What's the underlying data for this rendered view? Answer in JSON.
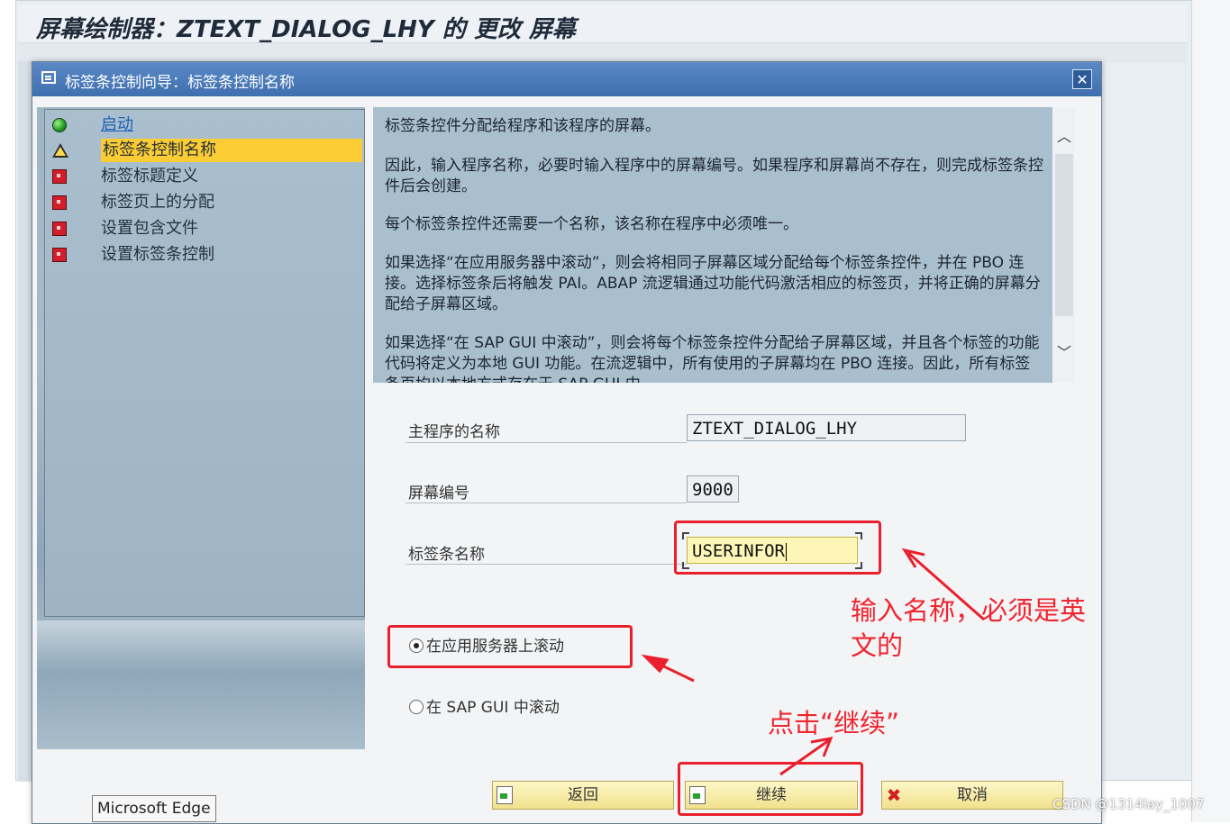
{
  "background_window": {
    "title": "屏幕绘制器：ZTEXT_DIALOG_LHY 的 更改 屏幕"
  },
  "dialog": {
    "title": "标签条控制向导：标签条控制名称",
    "close_label": "✕",
    "steps": [
      {
        "label": "启动",
        "status": "done",
        "icon": "green-light-icon"
      },
      {
        "label": "标签条控制名称",
        "status": "current",
        "icon": "warning-triangle-icon"
      },
      {
        "label": "标签标题定义",
        "status": "pending",
        "icon": "red-square-icon"
      },
      {
        "label": "标签页上的分配",
        "status": "pending",
        "icon": "red-square-icon"
      },
      {
        "label": "设置包含文件",
        "status": "pending",
        "icon": "red-square-icon"
      },
      {
        "label": "设置标签条控制",
        "status": "pending",
        "icon": "red-square-icon"
      }
    ],
    "help_paragraphs": [
      "标签条控件分配给程序和该程序的屏幕。",
      "因此，输入程序名称，必要时输入程序中的屏幕编号。如果程序和屏幕尚不存在，则完成标签条控件后会创建。",
      "每个标签条控件还需要一个名称，该名称在程序中必须唯一。",
      "如果选择“在应用服务器中滚动”，则会将相同子屏幕区域分配给每个标签条控件，并在 PBO 连接。选择标签条后将触发 PAI。ABAP 流逻辑通过功能代码激活相应的标签页，并将正确的屏幕分配给子屏幕区域。",
      "如果选择“在 SAP GUI 中滚动”，则会将每个标签条控件分配给子屏幕区域，并且各个标签的功能代码将定义为本地 GUI 功能。在流逻辑中，所有使用的子屏幕均在 PBO 连接。因此，所有标签条页均以本地方式存在于 SAP GUI 中。"
    ],
    "form": {
      "main_program_label": "主程序的名称",
      "main_program_value": "ZTEXT_DIALOG_LHY",
      "screen_number_label": "屏幕编号",
      "screen_number_value": "9000",
      "tabstrip_name_label": "标签条名称",
      "tabstrip_name_value": "USERINFOR"
    },
    "radio_options": [
      {
        "label": "在应用服务器上滚动",
        "selected": true
      },
      {
        "label": "在 SAP GUI 中滚动",
        "selected": false
      }
    ],
    "buttons": {
      "back": "返回",
      "continue": "继续",
      "cancel": "取消"
    }
  },
  "annotations": {
    "input_note_line1": "输入名称，必须是英",
    "input_note_line2": "文的",
    "click_note": "点击“继续”"
  },
  "tooltip": "Microsoft Edge",
  "watermark": "CSDN @1314lay_1007",
  "colors": {
    "titlebar": "#4a7bbd",
    "active_step": "#fbcc33",
    "annotation_red": "#e9202b",
    "button_yellow": "#f6eaa6"
  }
}
